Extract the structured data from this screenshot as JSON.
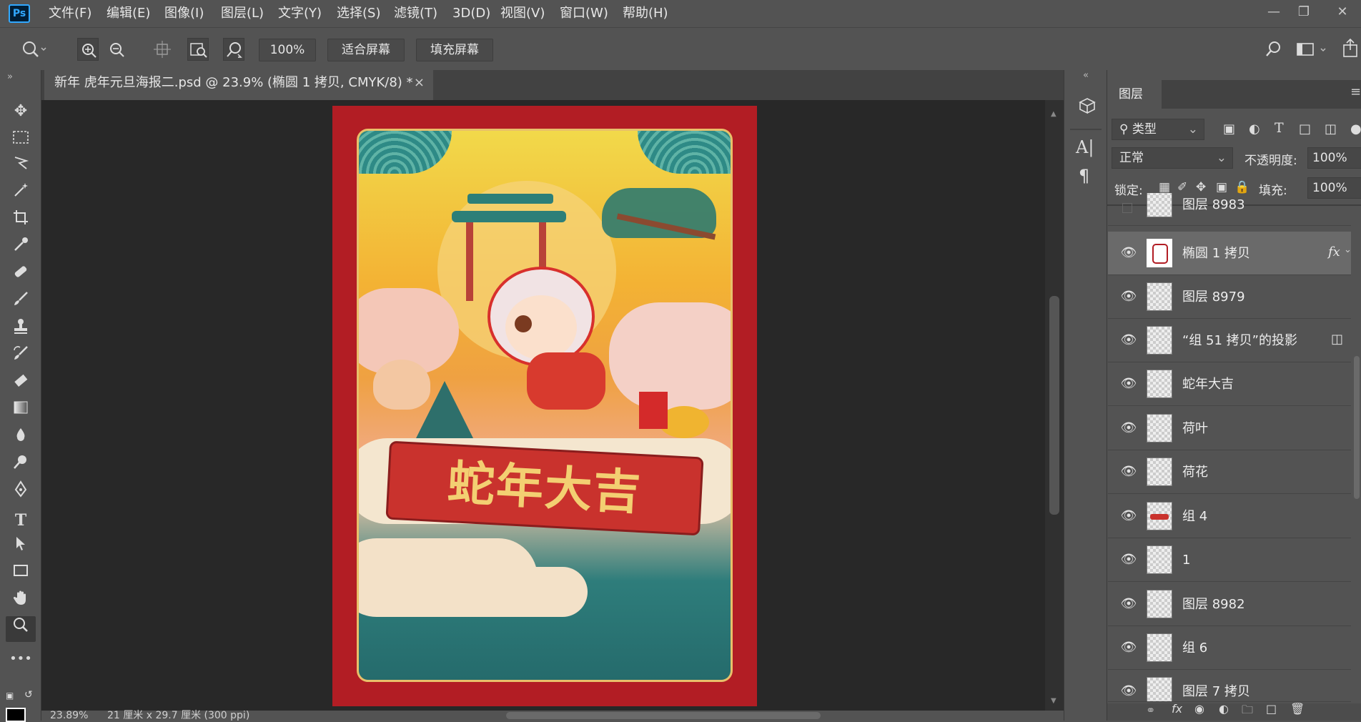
{
  "menubar": {
    "logo": "Ps",
    "items": [
      "文件(F)",
      "编辑(E)",
      "图像(I)",
      "图层(L)",
      "文字(Y)",
      "选择(S)",
      "滤镜(T)",
      "3D(D)",
      "视图(V)",
      "窗口(W)",
      "帮助(H)"
    ],
    "window_controls": [
      "minimize",
      "restore",
      "close"
    ]
  },
  "options": {
    "zoom_value": "100%",
    "fit_screen": "适合屏幕",
    "fill_screen": "填充屏幕"
  },
  "document": {
    "tab_title": "新年 虎年元旦海报二.psd @ 23.9% (椭圆 1 拷贝, CMYK/8) *",
    "close_glyph": "×",
    "poster_text": "蛇年大吉",
    "colors": {
      "frame": "#b21d24",
      "border": "#e8c06a",
      "teal": "#2e7d7b",
      "banner": "#c9322d",
      "text_gold": "#f3cf72"
    }
  },
  "status": {
    "zoom": "23.89%",
    "size": "21 厘米 x 29.7 厘米 (300 ppi)"
  },
  "layers_panel": {
    "title": "图层",
    "filter_kind": "类型",
    "blend_mode": "正常",
    "opacity_label": "不透明度:",
    "opacity_value": "100%",
    "lock_label": "锁定:",
    "fill_label": "填充:",
    "fill_value": "100%",
    "fx_label": "fx",
    "layers": [
      {
        "name": "图层 8983",
        "visible": false
      },
      {
        "name": "椭圆 1 拷贝",
        "visible": true,
        "selected": true,
        "fx": true
      },
      {
        "name": "图层 8979",
        "visible": true
      },
      {
        "name": "“组 51 拷贝”的投影",
        "visible": true
      },
      {
        "name": "蛇年大吉",
        "visible": true
      },
      {
        "name": "荷叶",
        "visible": true
      },
      {
        "name": "荷花",
        "visible": true
      },
      {
        "name": "组 4",
        "visible": true
      },
      {
        "name": "1",
        "visible": true
      },
      {
        "name": "图层 8982",
        "visible": true
      },
      {
        "name": "组 6",
        "visible": true
      },
      {
        "name": "图层 7 拷贝",
        "visible": true
      }
    ]
  }
}
